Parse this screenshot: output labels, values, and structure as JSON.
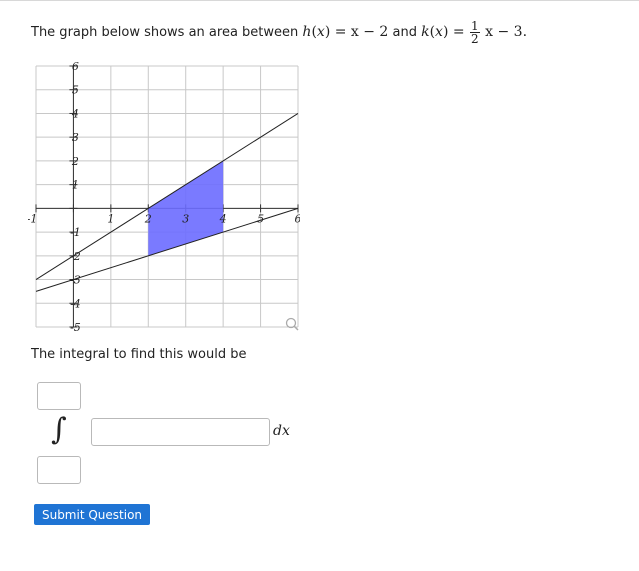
{
  "question": {
    "intro": "The graph below shows an area between",
    "h_name": "h",
    "h_var": "x",
    "h_rhs": "x − 2",
    "conj": "and",
    "k_name": "k",
    "k_var": "x",
    "k_frac_num": "1",
    "k_frac_den": "2",
    "k_rest": "x − 3."
  },
  "graph": {
    "x_tick_labels": [
      "-1",
      "1",
      "2",
      "3",
      "4",
      "5",
      "6"
    ],
    "y_tick_labels": [
      "6",
      "5",
      "4",
      "3",
      "2",
      "1",
      "-1",
      "-2",
      "-3",
      "-4",
      "-5"
    ],
    "xlim": [
      -1,
      6
    ],
    "ylim": [
      -5,
      6
    ],
    "shaded_region": {
      "x_from": 2,
      "x_to": 4
    },
    "lines": [
      "h(x) = x − 2",
      "k(x) = 1/2 x − 3"
    ],
    "fill_color": "#6b6bff",
    "zoom_icon": "magnifier-icon"
  },
  "integral": {
    "label": "The integral to find this would be",
    "symbol": "∫",
    "upper_value": "",
    "lower_value": "",
    "integrand_value": "",
    "dx_label": "dx"
  },
  "submit_label": "Submit Question"
}
